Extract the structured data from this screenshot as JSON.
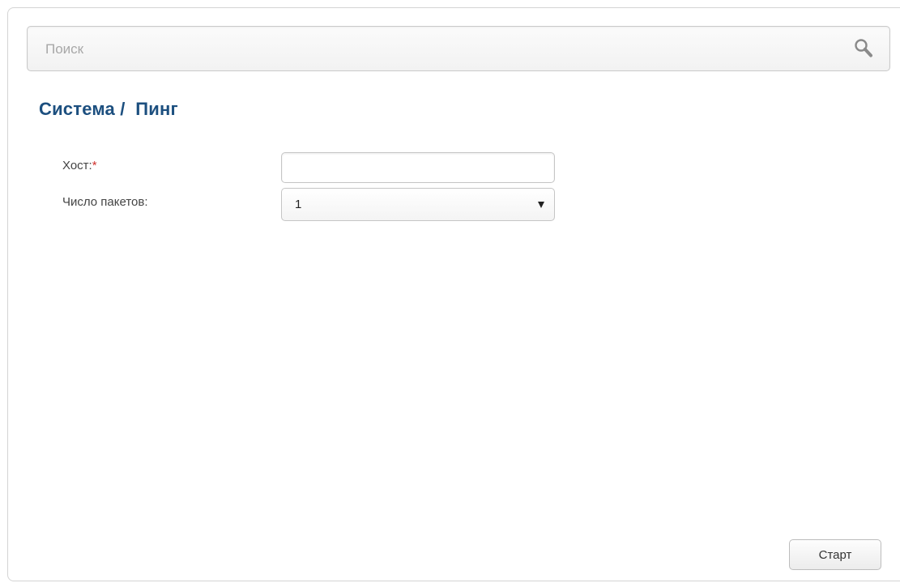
{
  "search": {
    "placeholder": "Поиск",
    "icon": "search-icon"
  },
  "page": {
    "title": "Система /  Пинг"
  },
  "form": {
    "host_label": "Хост:",
    "host_required_mark": "*",
    "host_value": "",
    "packets_label": "Число пакетов:",
    "packets_value": "1"
  },
  "actions": {
    "start_label": "Старт"
  },
  "colors": {
    "title": "#1c4f7f",
    "required": "#d0312d",
    "border": "#c5c5c5"
  }
}
